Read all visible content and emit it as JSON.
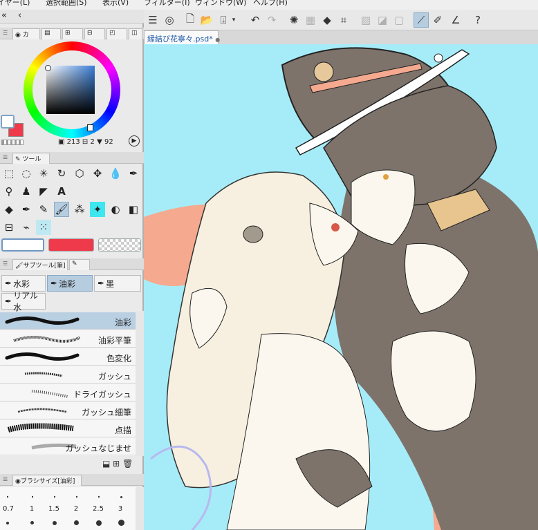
{
  "menu": {
    "items": [
      "イヤー(L)",
      "選択範囲(S)",
      "表示(V)",
      "フィルター(I)",
      "ウィンドウ(W)",
      "ヘルプ(H)"
    ]
  },
  "document": {
    "tab_title": "縁結び花寧々.psd*",
    "close_glyph": "●"
  },
  "left_panel": {
    "collapse_left": "«",
    "collapse_inner": "‹",
    "color_tab_letter": "カ",
    "color_readout": {
      "a": "213",
      "b": "2",
      "c": "92"
    },
    "tool_tab": "ツール",
    "subtool_tab": "サブツール[筆]",
    "brushsize_tab": "ブラシサイズ[油彩]"
  },
  "subtool_groups": [
    {
      "label": "水彩",
      "selected": false
    },
    {
      "label": "油彩",
      "selected": true
    },
    {
      "label": "墨",
      "selected": false
    },
    {
      "label": "リアル水",
      "selected": false
    }
  ],
  "brushes": [
    {
      "label": "油彩",
      "selected": true
    },
    {
      "label": "油彩平筆",
      "selected": false
    },
    {
      "label": "色変化",
      "selected": false
    },
    {
      "label": "ガッシュ",
      "selected": false
    },
    {
      "label": "ドライガッシュ",
      "selected": false
    },
    {
      "label": "ガッシュ細筆",
      "selected": false
    },
    {
      "label": "点描",
      "selected": false
    },
    {
      "label": "ガッシュなじませ",
      "selected": false
    }
  ],
  "brush_sizes": [
    "0.7",
    "1",
    "1.5",
    "2",
    "2.5",
    "3"
  ],
  "colors": {
    "main": "#ffffff",
    "sub": "#ef3a4b",
    "accent": "#b6cde0",
    "sky": "#a6ecf8",
    "peach": "#f5a98e"
  }
}
